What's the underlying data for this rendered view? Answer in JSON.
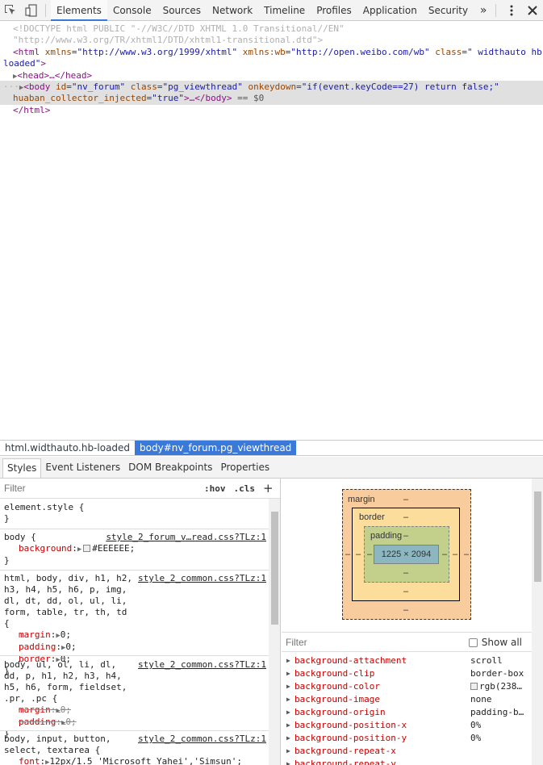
{
  "toolbar": {
    "tabs": [
      "Elements",
      "Console",
      "Sources",
      "Network",
      "Timeline",
      "Profiles",
      "Application",
      "Security"
    ],
    "selected_tab": "Elements",
    "more_label": "»"
  },
  "dom": {
    "l1a": "<!DOCTYPE html PUBLIC \"-//W3C//DTD XHTML 1.0 Transitional//EN\"",
    "l1b": "\"http://www.w3.org/TR/xhtml1/DTD/xhtml1-transitional.dtd\">",
    "html_open_a": "<html",
    "html_attr1_name": " xmlns",
    "html_attr1_val": "\"http://www.w3.org/1999/xhtml\"",
    "html_attr2_name": " xmlns:wb",
    "html_attr2_val": "\"http://open.weibo.com/wb\"",
    "html_attr3_name": " class",
    "html_attr3_val": "\" widthauto hb-",
    "html_attr3_val_cont": "loaded\"",
    "html_close_bracket": ">",
    "head": "<head>…</head>",
    "body_tag": "<body",
    "body_id_name": " id",
    "body_id_val": "\"nv_forum\"",
    "body_class_name": " class",
    "body_class_val": "\"pg_viewthread\"",
    "body_onkey_name": " onkeydown",
    "body_onkey_val": "\"if(event.keyCode==27) return false;\"",
    "body_huaban_name": "huaban_collector_injected",
    "body_huaban_val": "\"true\"",
    "body_end": ">…</body>",
    "body_eq": " == $0",
    "html_close": "</html>",
    "dots": "···"
  },
  "breadcrumbs": [
    "html.widthauto.hb-loaded",
    "body#nv_forum.pg_viewthread"
  ],
  "subtabs": [
    "Styles",
    "Event Listeners",
    "DOM Breakpoints",
    "Properties"
  ],
  "styles": {
    "filter_placeholder": "Filter",
    "hov": ":hov",
    "cls": ".cls",
    "plus": "+",
    "element_style": "element.style {",
    "close_brace": "}",
    "rule1_selector": "body {",
    "rule1_source": "style_2_forum_v…read.css?TLz:1",
    "rule1_prop": "background",
    "rule1_val": "#EEEEEE;",
    "rule2_selector": "html, body, div, h1, h2, h3, h4, h5, h6, p, img, dl, dt, dd, ol, ul, li, form, table, tr, th, td {",
    "rule2_source": "style_2_common.css?TLz:1",
    "rule2_props": [
      {
        "name": "margin",
        "val": "0;"
      },
      {
        "name": "padding",
        "val": "0;"
      },
      {
        "name": "border",
        "val": "0;"
      }
    ],
    "rule3_selector": "body, ul, ol, li, dl, dd, p, h1, h2, h3, h4, h5, h6, form, fieldset, .pr, .pc {",
    "rule3_source": "style_2_common.css?TLz:1",
    "rule3_props": [
      {
        "name": "margin",
        "val": "0;"
      },
      {
        "name": "padding",
        "val": "0;"
      }
    ],
    "rule4_selector": "body, input, button, select, textarea {",
    "rule4_source": "style_2_common.css?TLz:1",
    "rule4_prop": "font",
    "rule4_val": "12px/1.5 'Microsoft Yahei','Simsun';"
  },
  "metrics": {
    "margin_label": "margin",
    "border_label": "border",
    "padding_label": "padding",
    "dash": "–",
    "content_size": "1225 × 2094"
  },
  "computed": {
    "filter_placeholder": "Filter",
    "show_all": "Show all",
    "rows": [
      {
        "name": "background-attachment",
        "val": "scroll"
      },
      {
        "name": "background-clip",
        "val": "border-box"
      },
      {
        "name": "background-color",
        "val": "rgb(238…"
      },
      {
        "name": "background-image",
        "val": "none"
      },
      {
        "name": "background-origin",
        "val": "padding-b…"
      },
      {
        "name": "background-position-x",
        "val": "0%"
      },
      {
        "name": "background-position-y",
        "val": "0%"
      },
      {
        "name": "background-repeat-x",
        "val": ""
      },
      {
        "name": "background-repeat-y",
        "val": ""
      }
    ]
  }
}
